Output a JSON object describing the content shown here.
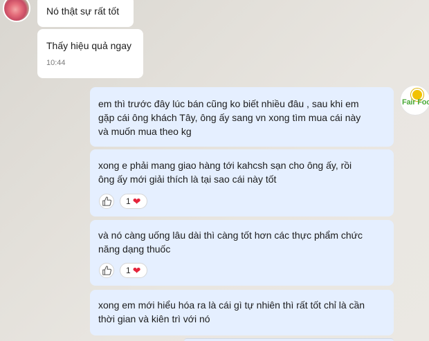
{
  "incoming": {
    "msg1": {
      "text": "Nó thật sự rất tốt"
    },
    "msg2": {
      "text": "Thấy hiệu quả ngay",
      "time": "10:44"
    }
  },
  "outgoing": {
    "avatar_text": "Fair Foo",
    "msg1": {
      "text": "em thì trước đây lúc bán cũng ko biết nhiều đâu , sau khi em\ngặp cái ông khách Tây, ông ấy sang vn xong tìm mua cái này\nvà muốn mua theo kg"
    },
    "msg2": {
      "text": "xong e phải mang giao hàng tới kahcsh sạn cho ông ấy, rồi\nông ấy mới giải thích là tại sao cái này tốt",
      "reaction_count": "1"
    },
    "msg3": {
      "text": "và nó càng uống lâu dài thì càng tốt hơn các thực phẩm chức\nnăng dạng thuốc",
      "reaction_count": "1"
    },
    "msg4": {
      "text": "xong em mới hiểu hóa ra là cái gì tự nhiên thì rất tốt chỉ là cần\nthời gian và kiên trì với nó"
    }
  },
  "icons": {
    "like": "thumbs-up-icon",
    "reaction": "heart-icon"
  },
  "colors": {
    "outgoing_bubble": "#e5efff",
    "incoming_bubble": "#ffffff",
    "heart": "#e5243b"
  }
}
